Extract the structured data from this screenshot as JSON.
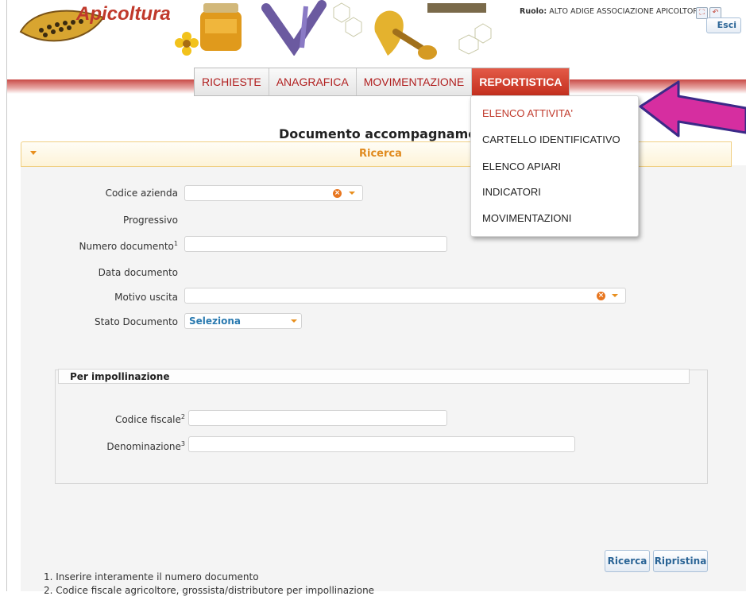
{
  "header": {
    "logo_text": "Apicoltura",
    "role_label": "Ruolo:",
    "role_value": "ALTO ADIGE ASSOCIAZIONE APICOLTORI",
    "logout_label": "Esci"
  },
  "nav": {
    "items": [
      {
        "label": "RICHIESTE"
      },
      {
        "label": "ANAGRAFICA"
      },
      {
        "label": "MOVIMENTAZIONE"
      },
      {
        "label": "REPORTISTICA"
      }
    ]
  },
  "dropdown": {
    "items": [
      {
        "label": "ELENCO ATTIVITA'"
      },
      {
        "label": "CARTELLO IDENTIFICATIVO"
      },
      {
        "label": "ELENCO APIARI"
      },
      {
        "label": "INDICATORI"
      },
      {
        "label": "MOVIMENTAZIONI"
      }
    ]
  },
  "page": {
    "title": "Documento accompagnamen"
  },
  "search": {
    "panel_title": "Ricerca",
    "fields": {
      "codice_azienda": {
        "label": "Codice azienda",
        "value": ""
      },
      "progressivo": {
        "label": "Progressivo"
      },
      "numero_documento": {
        "label": "Numero documento",
        "sup": "1",
        "value": ""
      },
      "data_documento": {
        "label": "Data documento"
      },
      "motivo_uscita": {
        "label": "Motivo uscita",
        "value": ""
      },
      "stato_documento": {
        "label": "Stato Documento",
        "value": "Seleziona"
      }
    },
    "impollinazione": {
      "legend": "Per impollinazione",
      "codice_fiscale": {
        "label": "Codice fiscale",
        "sup": "2",
        "value": ""
      },
      "denominazione": {
        "label": "Denominazione",
        "sup": "3",
        "value": ""
      }
    },
    "buttons": {
      "search": "Ricerca",
      "reset": "Ripristina"
    }
  },
  "notes": [
    "1. Inserire interamente il numero documento",
    "2. Codice fiscale agricoltore, grossista/distributore per impollinazione"
  ],
  "colors": {
    "brand_red": "#c0392b",
    "accent_orange": "#e08a1e",
    "arrow_magenta": "#d62ea0",
    "arrow_outline": "#3b2a88"
  }
}
